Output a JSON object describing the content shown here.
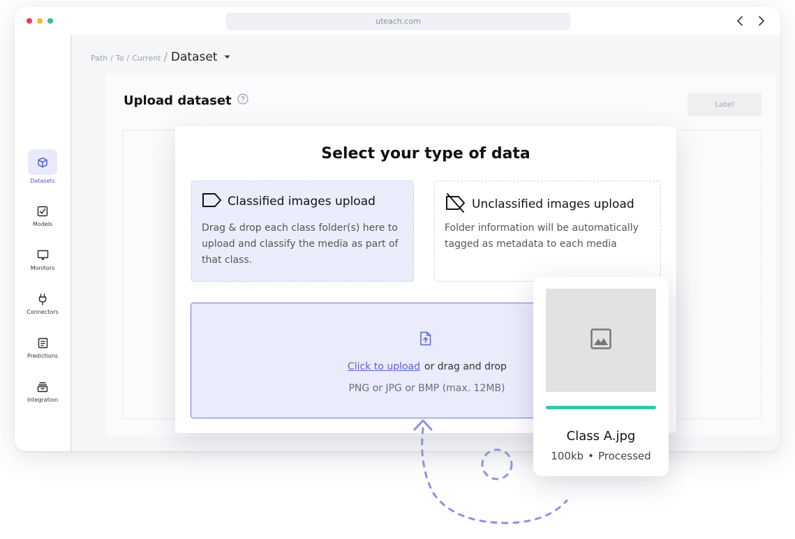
{
  "browser": {
    "url": "uteach.com",
    "back_icon": "chevron-left-icon",
    "forward_icon": "chevron-right-icon"
  },
  "sidebar": {
    "items": [
      {
        "label": "Datasets",
        "icon": "cube-icon",
        "active": true
      },
      {
        "label": "Models",
        "icon": "chart-icon",
        "active": false
      },
      {
        "label": "Monitors",
        "icon": "monitor-icon",
        "active": false
      },
      {
        "label": "Connectors",
        "icon": "plug-icon",
        "active": false
      },
      {
        "label": "Predictions",
        "icon": "document-icon",
        "active": false
      },
      {
        "label": "Integration",
        "icon": "stack-icon",
        "active": false
      }
    ]
  },
  "breadcrumb": {
    "path": [
      "Path",
      "To",
      "Current"
    ],
    "current": "Dataset"
  },
  "panel": {
    "title": "Upload dataset",
    "label_button": "Label"
  },
  "modal": {
    "title": "Select your type of data",
    "options": [
      {
        "title": "Classified images upload",
        "description": "Drag & drop each class folder(s) here to upload and classify the media as part of that class.",
        "icon": "tag-icon"
      },
      {
        "title": "Unclassified images upload",
        "description": "Folder information will be automatically tagged as metadata to each media",
        "icon": "tag-off-icon"
      }
    ],
    "upload": {
      "link": "Click to upload",
      "rest": "or drag and drop",
      "hint": "PNG or JPG or BMP (max. 12MB)"
    }
  },
  "file_card": {
    "name": "Class A.jpg",
    "size": "100kb",
    "separator": "•",
    "status": "Processed",
    "progress": 1.0
  },
  "colors": {
    "accent": "#5964d6",
    "progress": "#37c6a5",
    "active_bg": "#e8eafb"
  }
}
